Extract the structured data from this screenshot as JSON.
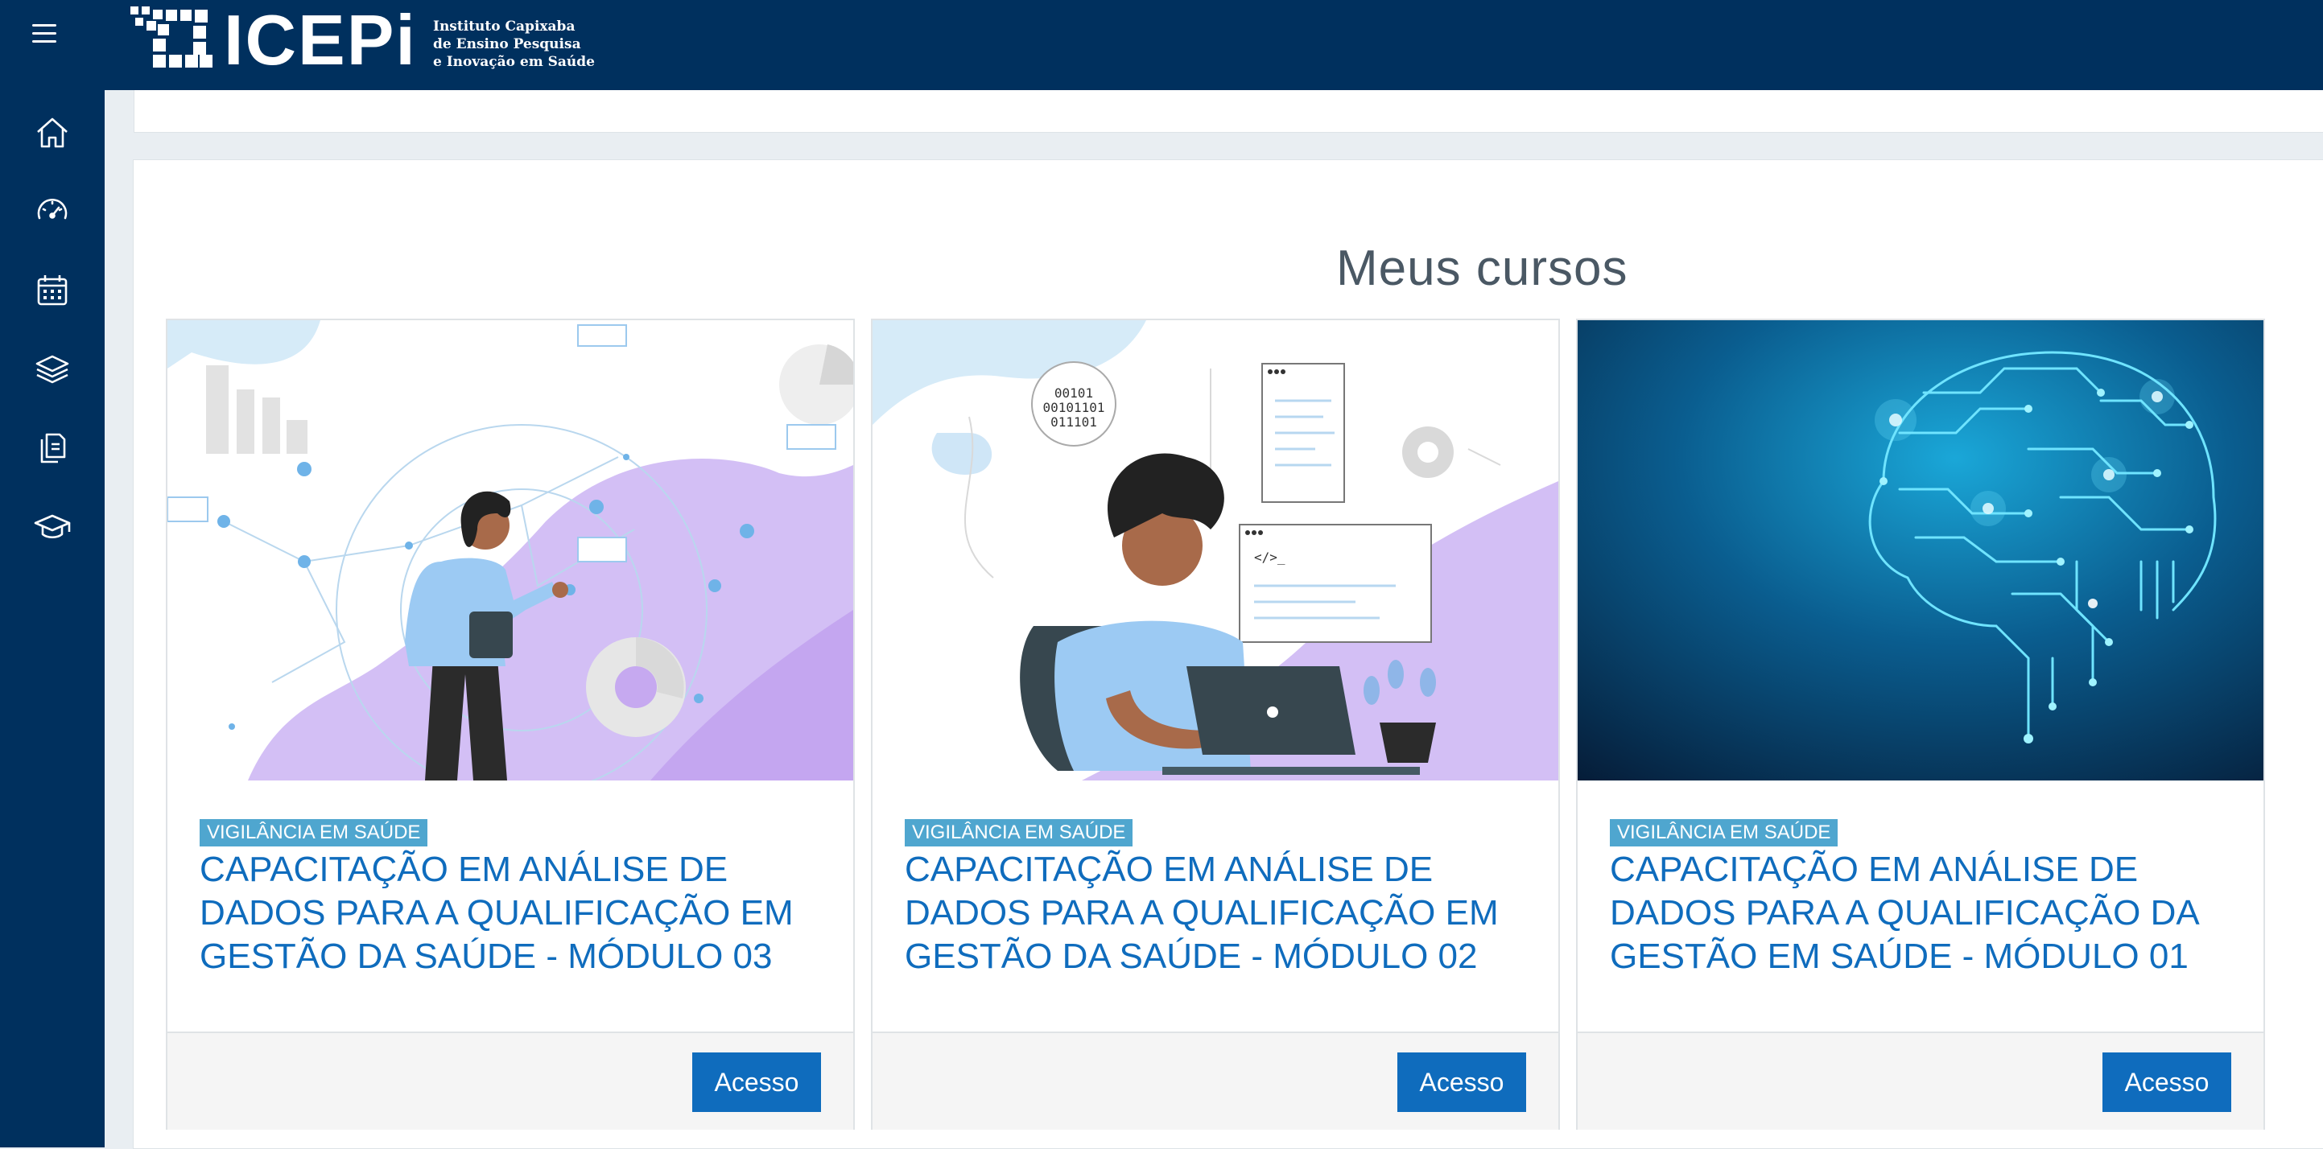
{
  "header": {
    "menu_icon": "hamburger-icon",
    "logo": {
      "name": "ICEPi",
      "subtitle_lines": [
        "Instituto Capixaba",
        "de Ensino Pesquisa",
        "e Inovação em Saúde"
      ]
    }
  },
  "sidebar": {
    "items": [
      {
        "icon": "home-icon"
      },
      {
        "icon": "dashboard-gauge-icon"
      },
      {
        "icon": "calendar-icon"
      },
      {
        "icon": "layers-icon"
      },
      {
        "icon": "content-bank-icon"
      },
      {
        "icon": "graduation-cap-icon"
      }
    ]
  },
  "main": {
    "title": "Meus cursos",
    "courses": [
      {
        "category": "VIGILÂNCIA EM SAÚDE",
        "title": "CAPACITAÇÃO EM ANÁLISE DE DADOS PARA A QUALIFICAÇÃO EM GESTÃO DA SAÚDE - MÓDULO 03",
        "button": "Acesso",
        "image": "illustration-woman-data-analysis"
      },
      {
        "category": "VIGILÂNCIA EM SAÚDE",
        "title": "CAPACITAÇÃO EM ANÁLISE DE DADOS PARA A QUALIFICAÇÃO EM GESTÃO DA SAÚDE - MÓDULO 02",
        "button": "Acesso",
        "image": "illustration-programmer-laptop"
      },
      {
        "category": "VIGILÂNCIA EM SAÚDE",
        "title": "CAPACITAÇÃO EM ANÁLISE DE DADOS PARA A QUALIFICAÇÃO DA GESTÃO EM SAÚDE - MÓDULO 01",
        "button": "Acesso",
        "image": "illustration-circuit-brain"
      }
    ]
  },
  "colors": {
    "navy": "#00305e",
    "link_blue": "#0f6cbd",
    "badge": "#4fa6cf",
    "purple": "#c9a8f2"
  }
}
